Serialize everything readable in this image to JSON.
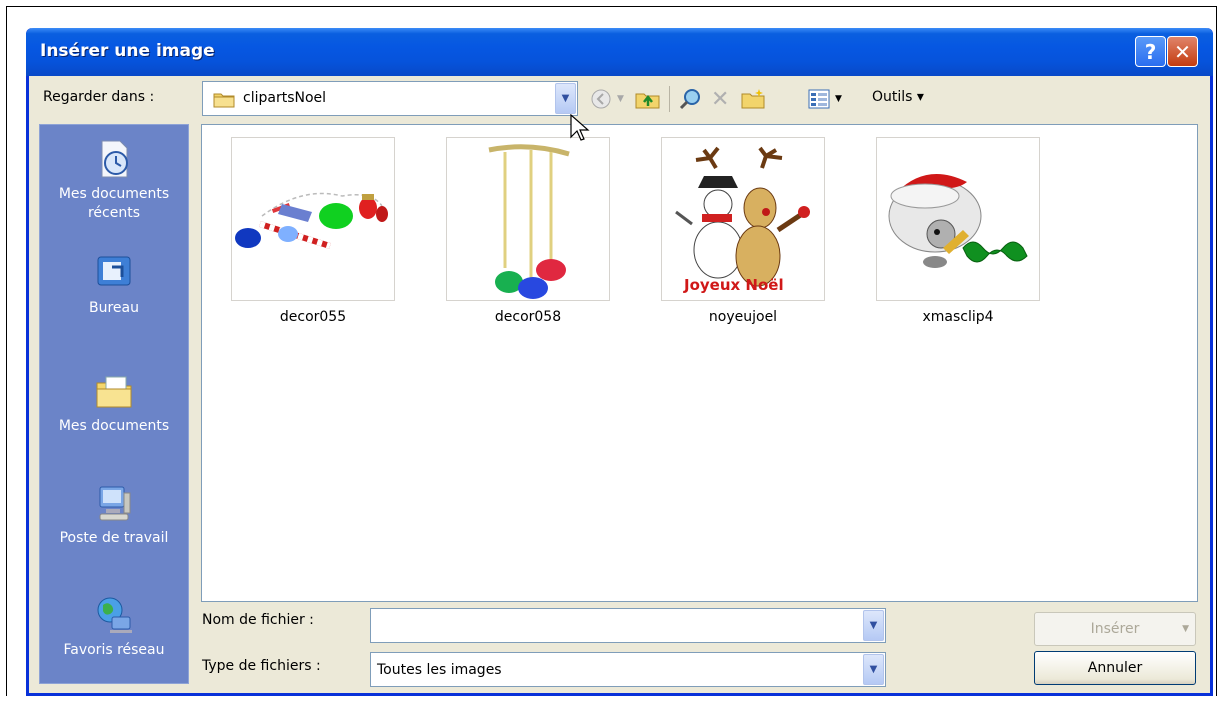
{
  "window": {
    "title": "Insérer une image",
    "help_label": "?",
    "close_label": "✕"
  },
  "lookin": {
    "label": "Regarder dans :",
    "value": "clipartsNoel"
  },
  "toolbar": {
    "tools_label": "Outils"
  },
  "places": [
    {
      "label": "Mes documents récents",
      "icon": "recent-documents-icon"
    },
    {
      "label": "Bureau",
      "icon": "desktop-icon"
    },
    {
      "label": "Mes documents",
      "icon": "my-documents-icon"
    },
    {
      "label": "Poste de travail",
      "icon": "my-computer-icon"
    },
    {
      "label": "Favoris réseau",
      "icon": "network-places-icon"
    }
  ],
  "files": [
    {
      "name": "decor055"
    },
    {
      "name": "decor058"
    },
    {
      "name": "noyeujoel",
      "caption": "Joyeux Noël"
    },
    {
      "name": "xmasclip4"
    }
  ],
  "filename": {
    "label": "Nom de fichier :",
    "value": ""
  },
  "filetype": {
    "label": "Type de fichiers :",
    "value": "Toutes les images"
  },
  "buttons": {
    "insert": "Insérer",
    "cancel": "Annuler"
  },
  "colors": {
    "title_bar": "#0657e2",
    "dialog_bg": "#ece9d8",
    "places_bar": "#6b84c8"
  }
}
